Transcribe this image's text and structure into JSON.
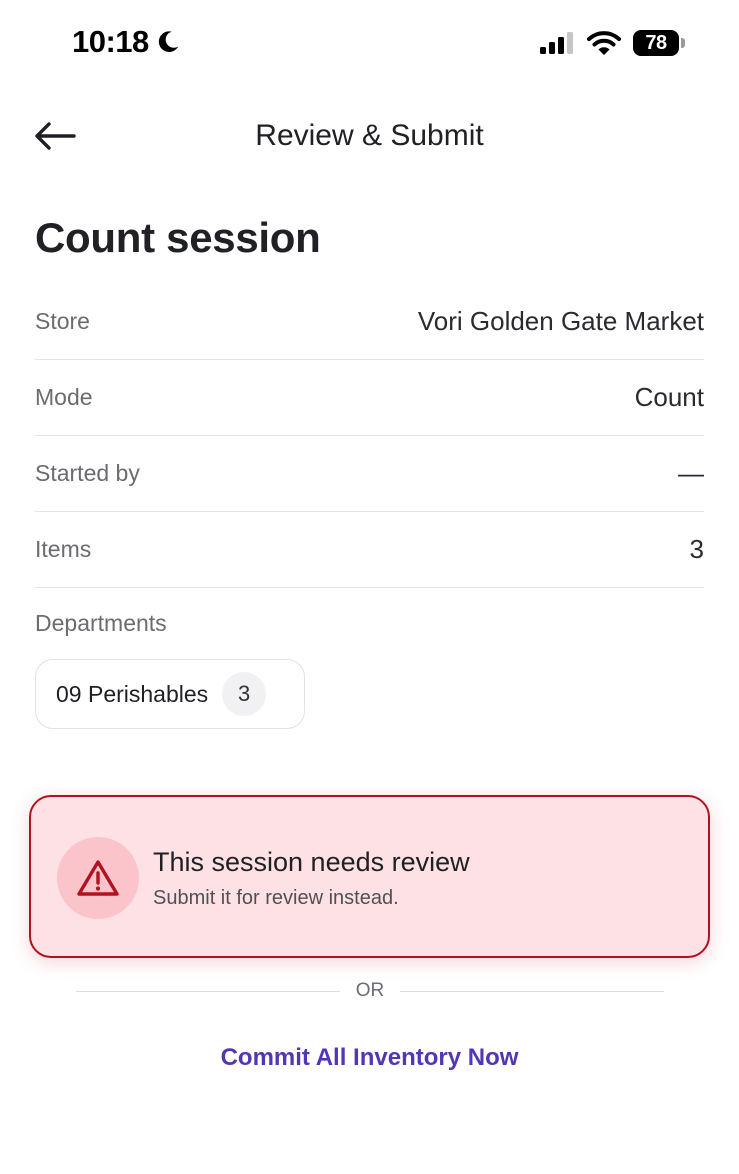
{
  "status_bar": {
    "time": "10:18",
    "battery": "78"
  },
  "header": {
    "title": "Review & Submit"
  },
  "section": {
    "title": "Count session",
    "rows": [
      {
        "label": "Store",
        "value": "Vori Golden Gate Market"
      },
      {
        "label": "Mode",
        "value": "Count"
      },
      {
        "label": "Started by",
        "value": "—"
      },
      {
        "label": "Items",
        "value": "3"
      }
    ],
    "departments_label": "Departments",
    "departments": [
      {
        "name": "09 Perishables",
        "count": "3"
      }
    ]
  },
  "review_notice": {
    "title": "This session needs review",
    "subtitle": "Submit it for review instead.",
    "icon": "warning-triangle-icon"
  },
  "divider": {
    "text": "OR"
  },
  "commit_link": {
    "label": "Commit All Inventory Now"
  },
  "colors": {
    "accent": "#5336b3",
    "alert_border": "#b0121f",
    "alert_background": "#fde1e4"
  }
}
